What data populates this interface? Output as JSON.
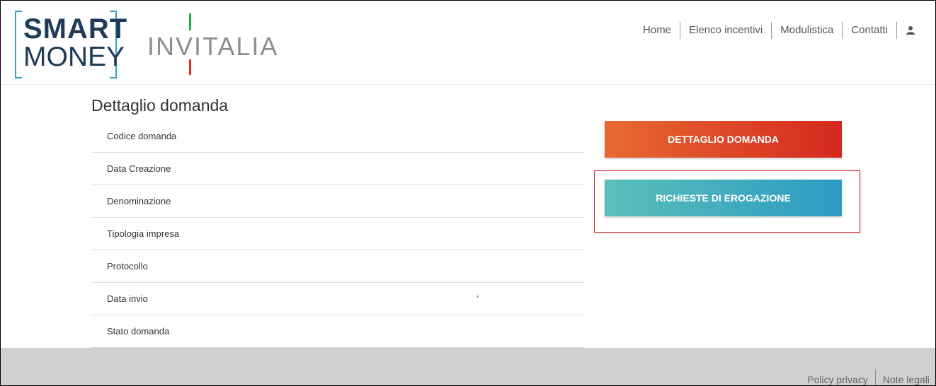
{
  "logo": {
    "smart": "SMART",
    "money": "MONEY",
    "invitalia": "INVITALIA"
  },
  "nav": {
    "items": [
      "Home",
      "Elenco incentivi",
      "Modulistica",
      "Contatti"
    ]
  },
  "page": {
    "title": "Dettaglio domanda"
  },
  "details": {
    "rows": [
      {
        "label": "Codice domanda",
        "value": ""
      },
      {
        "label": "Data Creazione",
        "value": ""
      },
      {
        "label": "Denominazione",
        "value": ""
      },
      {
        "label": "Tipologia impresa",
        "value": ""
      },
      {
        "label": "Protocollo",
        "value": ""
      },
      {
        "label": "Data invio",
        "value": "'"
      },
      {
        "label": "Stato domanda",
        "value": ""
      }
    ]
  },
  "buttons": {
    "dettaglio": "DETTAGLIO DOMANDA",
    "richieste": "RICHIESTE DI EROGAZIONE"
  },
  "footer": {
    "links": [
      "Policy privacy",
      "Note legali"
    ]
  },
  "colors": {
    "accent_orange": "#e86a33",
    "accent_red": "#d4281f",
    "accent_teal": "#5bbfba",
    "accent_blue": "#2c9ac3",
    "highlight": "#d9262d"
  }
}
